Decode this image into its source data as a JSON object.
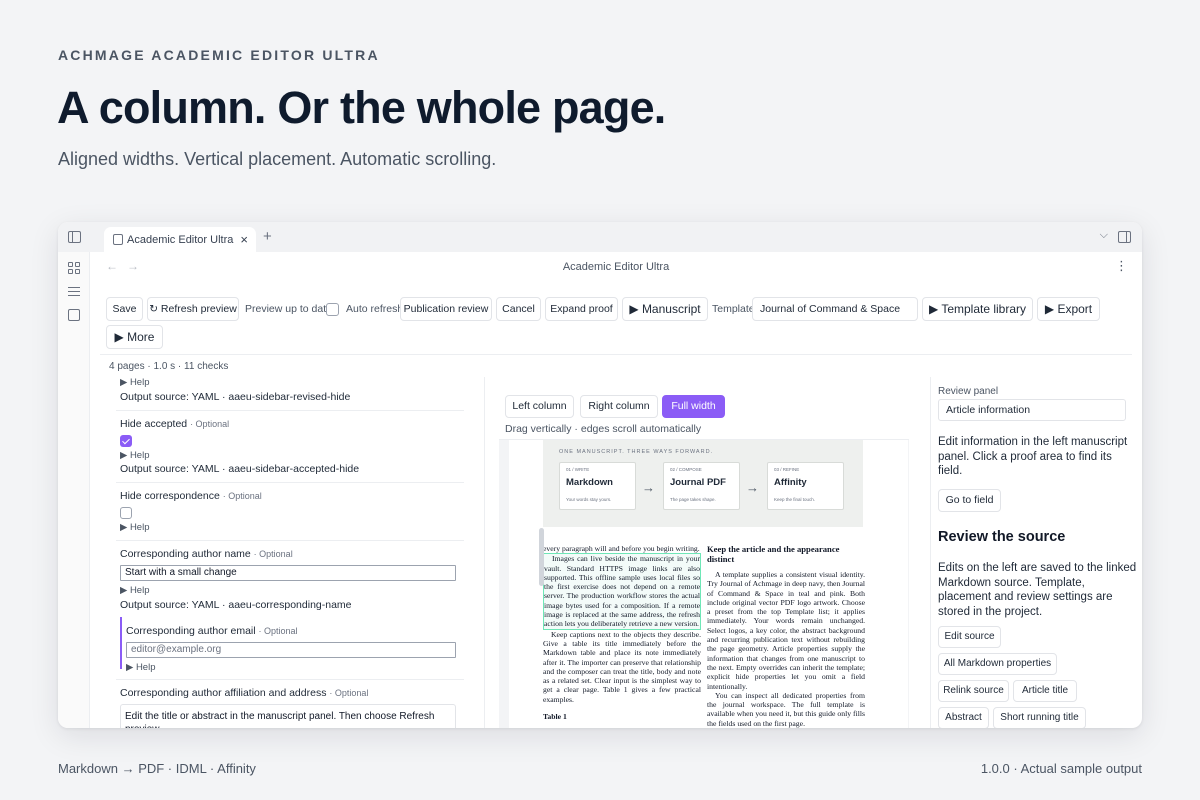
{
  "page": {
    "eyebrow": "ACHMAGE ACADEMIC EDITOR ULTRA",
    "headline": "A column. Or the whole page.",
    "subhead": "Aligned widths. Vertical placement. Automatic scrolling.",
    "footer_left": "Markdown → PDF · IDML · Affinity",
    "footer_right": "1.0.0 · Actual sample output"
  },
  "window": {
    "tab_label": "Academic Editor Ultra",
    "tab_close": "×",
    "new_tab": "+",
    "chevron": "⌵",
    "back": "←",
    "forward": "→",
    "doc_title": "Academic Editor Ultra",
    "more": "⋮"
  },
  "toolbar": {
    "save": "Save",
    "refresh_preview": "↻ Refresh preview",
    "preview_status": "Preview up to date",
    "auto_refresh": "Auto refresh",
    "publication_review": "Publication review",
    "cancel": "Cancel",
    "expand_proof": "Expand proof",
    "manuscript": "▶ Manuscript",
    "template_label": "Template",
    "template_value": "Journal of Command & Space",
    "template_library": "▶ Template library",
    "export": "▶ Export",
    "more": "▶ More"
  },
  "status": {
    "summary": "4 pages · 1.0 s · 11 checks"
  },
  "left_panel": {
    "help": "▶ Help",
    "output_revised": "Output source: YAML · aaeu-sidebar-revised-hide",
    "hide_accepted_label": "Hide accepted",
    "optional": "· Optional",
    "output_accepted": "Output source: YAML · aaeu-sidebar-accepted-hide",
    "hide_correspondence_label": "Hide correspondence",
    "corr_name_label": "Corresponding author name",
    "corr_name_value": "Start with a small change",
    "output_corr_name": "Output source: YAML · aaeu-corresponding-name",
    "corr_email_label": "Corresponding author email",
    "corr_email_placeholder": "editor@example.org",
    "corr_affil_label": "Corresponding author affiliation and address",
    "corr_affil_value": "Edit the title or abstract in the manuscript panel. Then choose Refresh preview."
  },
  "mid_panel": {
    "left_column": "Left column",
    "right_column": "Right column",
    "full_width": "Full width",
    "drag_hint": "Drag vertically · edges scroll automatically",
    "figure": {
      "eyebrow": "ONE MANUSCRIPT. THREE WAYS FORWARD.",
      "cards": [
        {
          "step": "01 / WRITE",
          "title": "Markdown",
          "tag": "Your words stay yours."
        },
        {
          "step": "02 / COMPOSE",
          "title": "Journal PDF",
          "tag": "The page takes shape."
        },
        {
          "step": "03 / REFINE",
          "title": "Affinity",
          "tag": "Keep the final touch."
        }
      ],
      "arrow": "→"
    },
    "left_col": {
      "p1": "every paragraph will and before you begin writing.",
      "p2": "Images can live beside the manuscript in your vault. Standard HTTPS image links are also supported. This offline sample uses local files so the first exercise does not depend on a remote server. The production workflow stores the actual image bytes used for a composition. If a remote image is replaced at the same address, the refresh action lets you deliberately retrieve a new version.",
      "p3": "Keep captions next to the objects they describe. Give a table its title immediately before the Markdown table and place its note immediately after it. The importer can preserve that relationship and the composer can treat the title, body and note as a related set. Clear input is the simplest way to get a clear page. Table 1 gives a few practical examples.",
      "p4": "Table 1"
    },
    "right_col": {
      "heading": "Keep the article and the appearance distinct",
      "p1": "A template supplies a consistent visual identity. Try Journal of Achmage in deep navy, then Journal of Command & Space in teal and pink. Both include original vector PDF logo artwork. Choose a preset from the top Template list; it applies immediately. Your words remain unchanged. Select logos, a key color, the abstract background and recurring publication text without rebuilding the page geometry. Article properties supply the information that changes from one manuscript to the next. Empty overrides can inherit the template; explicit hide properties let you omit a field intentionally.",
      "p2": "You can inspect all dedicated properties from the journal workspace. The full template is available when you need it, but this guide only fills the fields used on the first page."
    }
  },
  "right_panel": {
    "label": "Review panel",
    "select_value": "Article information",
    "para1": "Edit information in the left manuscript panel. Click a proof area to find its field.",
    "go_to_field": "Go to field",
    "heading": "Review the source",
    "para2": "Edits on the left are saved to the linked Markdown source. Template, placement and review settings are stored in the project.",
    "chips": [
      "Edit source",
      "All Markdown properties",
      "Relink source",
      "Article title",
      "Abstract",
      "Short running title"
    ]
  },
  "colors": {
    "accent": "#8b5cf6",
    "highlight": "#6ee7b7",
    "headline": "#0f1b2d"
  }
}
